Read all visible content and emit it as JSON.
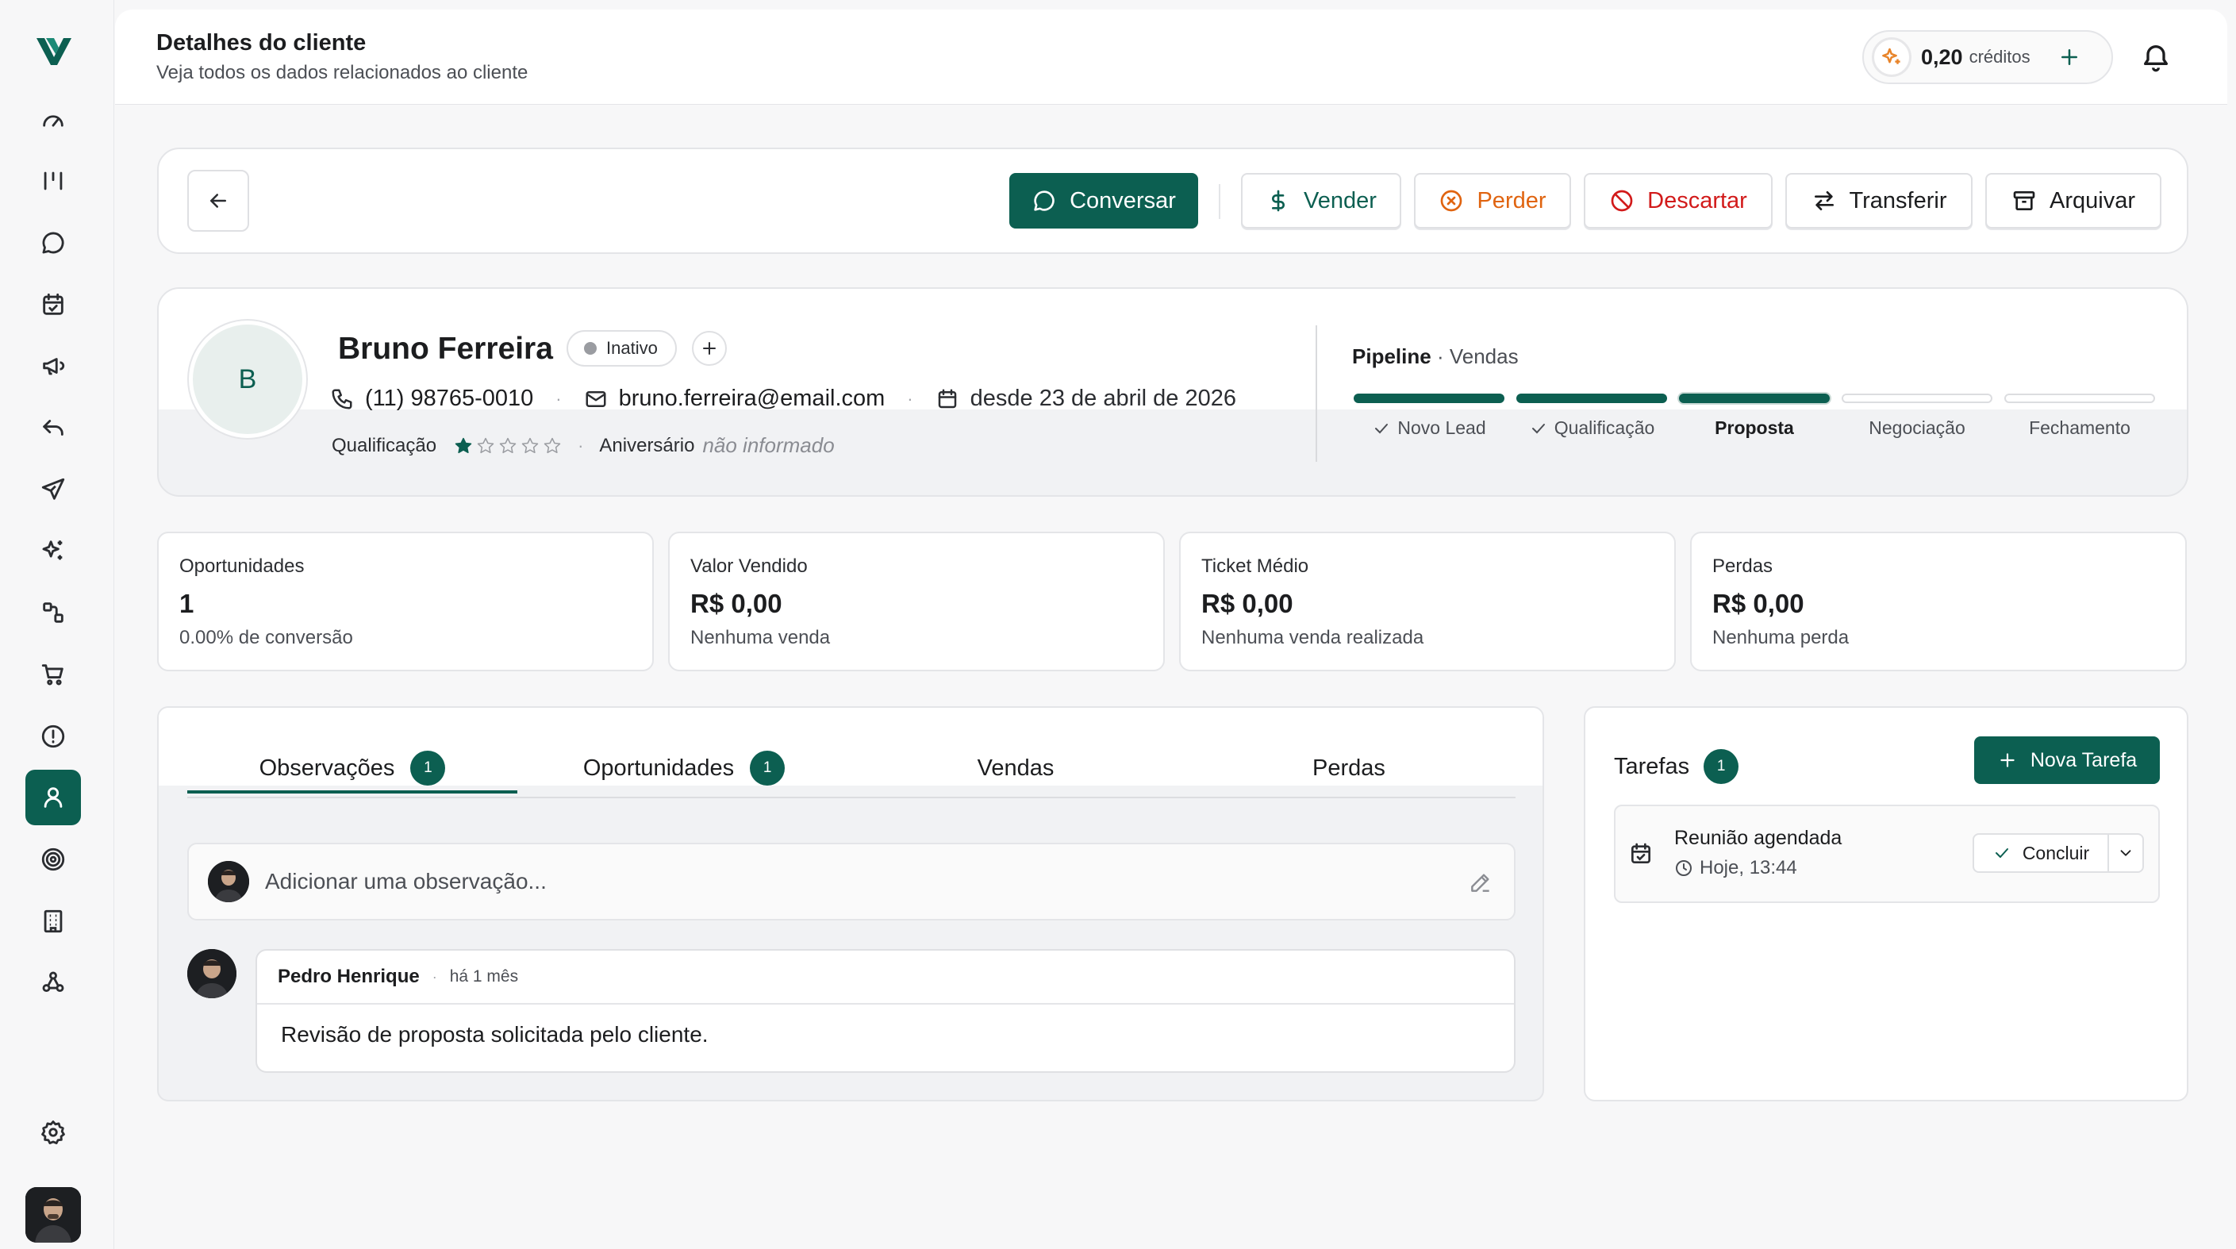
{
  "header": {
    "title": "Detalhes do cliente",
    "subtitle": "Veja todos os dados relacionados ao cliente",
    "credits_value": "0,20",
    "credits_label": "créditos"
  },
  "sidebar": {
    "items": [
      {
        "icon": "dashboard-gauge-icon",
        "active": false
      },
      {
        "icon": "kanban-columns-icon",
        "active": false
      },
      {
        "icon": "chat-bubble-icon",
        "active": false
      },
      {
        "icon": "calendar-check-icon",
        "active": false
      },
      {
        "icon": "megaphone-icon",
        "active": false
      },
      {
        "icon": "reply-arrow-icon",
        "active": false
      },
      {
        "icon": "send-plane-icon",
        "active": false
      },
      {
        "icon": "sparkles-icon",
        "active": false
      },
      {
        "icon": "workflow-icon",
        "active": false
      },
      {
        "icon": "shopping-cart-icon",
        "active": false
      },
      {
        "icon": "alert-circle-icon",
        "active": false
      },
      {
        "icon": "user-icon",
        "active": true
      },
      {
        "icon": "target-icon",
        "active": false
      },
      {
        "icon": "building-icon",
        "active": false
      },
      {
        "icon": "webhook-icon",
        "active": false
      },
      {
        "icon": "settings-gear-icon",
        "active": false
      }
    ]
  },
  "actions": {
    "conversar": "Conversar",
    "vender": "Vender",
    "perder": "Perder",
    "descartar": "Descartar",
    "transferir": "Transferir",
    "arquivar": "Arquivar"
  },
  "client": {
    "initial": "B",
    "name": "Bruno Ferreira",
    "status": "Inativo",
    "phone": "(11) 98765-0010",
    "email": "bruno.ferreira@email.com",
    "since": "desde 23 de abril de 2026",
    "qualification_label": "Qualificação",
    "rating": 1,
    "rating_max": 5,
    "birthday_label": "Aniversário",
    "birthday_value": "não informado"
  },
  "pipeline": {
    "label": "Pipeline",
    "name": "Vendas",
    "stages": [
      {
        "name": "Novo Lead",
        "state": "done"
      },
      {
        "name": "Qualificação",
        "state": "done"
      },
      {
        "name": "Proposta",
        "state": "current"
      },
      {
        "name": "Negociação",
        "state": "pending"
      },
      {
        "name": "Fechamento",
        "state": "pending"
      }
    ]
  },
  "stats": [
    {
      "label": "Oportunidades",
      "value": "1",
      "sub": "0.00% de conversão"
    },
    {
      "label": "Valor Vendido",
      "value": "R$ 0,00",
      "sub": "Nenhuma venda"
    },
    {
      "label": "Ticket Médio",
      "value": "R$ 0,00",
      "sub": "Nenhuma venda realizada"
    },
    {
      "label": "Perdas",
      "value": "R$ 0,00",
      "sub": "Nenhuma perda"
    }
  ],
  "tabs": [
    {
      "label": "Observações",
      "count": "1",
      "active": true
    },
    {
      "label": "Oportunidades",
      "count": "1",
      "active": false
    },
    {
      "label": "Vendas",
      "count": "",
      "active": false
    },
    {
      "label": "Perdas",
      "count": "",
      "active": false
    }
  ],
  "observations": {
    "placeholder": "Adicionar uma observação...",
    "items": [
      {
        "author": "Pedro Henrique",
        "time": "há 1 mês",
        "text": "Revisão de proposta solicitada pelo cliente."
      }
    ]
  },
  "tasks": {
    "title": "Tarefas",
    "count": "1",
    "new_label": "Nova Tarefa",
    "items": [
      {
        "title": "Reunião agendada",
        "when": "Hoje, 13:44",
        "action": "Concluir"
      }
    ]
  },
  "colors": {
    "brand": "#0c5f51",
    "orange": "#e06410",
    "red": "#d21a1a",
    "credits_spark": "#e8842a"
  }
}
